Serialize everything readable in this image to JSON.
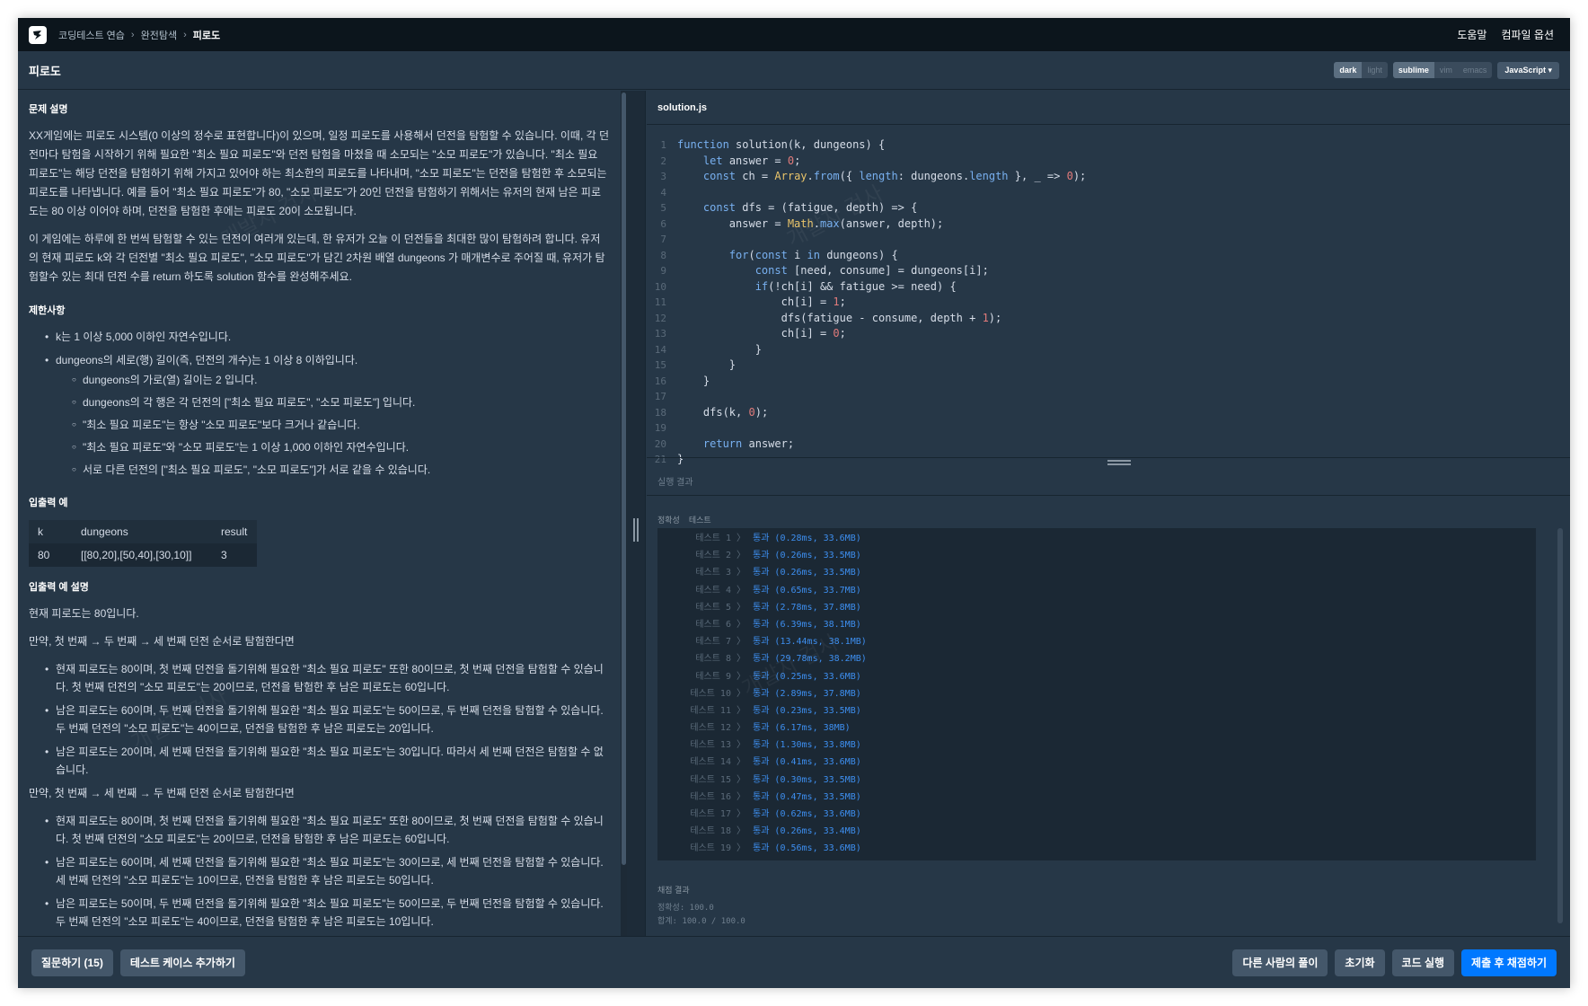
{
  "breadcrumb": [
    "코딩테스트 연습",
    "완전탐색",
    "피로도"
  ],
  "header_links": [
    "도움말",
    "컴파일 옵션"
  ],
  "title": "피로도",
  "theme_toggle": [
    "dark",
    "light"
  ],
  "keymap_toggle": [
    "sublime",
    "vim",
    "emacs"
  ],
  "language": "JavaScript",
  "problem": {
    "heading": "문제 설명",
    "paragraphs": [
      "XX게임에는 피로도 시스템(0 이상의 정수로 표현합니다)이 있으며, 일정 피로도를 사용해서 던전을 탐험할 수 있습니다. 이때, 각 던전마다 탐험을 시작하기 위해 필요한 \"최소 필요 피로도\"와 던전 탐험을 마쳤을 때 소모되는 \"소모 피로도\"가 있습니다. \"최소 필요 피로도\"는 해당 던전을 탐험하기 위해 가지고 있어야 하는 최소한의 피로도를 나타내며, \"소모 피로도\"는 던전을 탐험한 후 소모되는 피로도를 나타냅니다. 예를 들어 \"최소 필요 피로도\"가 80, \"소모 피로도\"가 20인 던전을 탐험하기 위해서는 유저의 현재 남은 피로도는 80 이상 이어야 하며, 던전을 탐험한 후에는 피로도 20이 소모됩니다.",
      "이 게임에는 하루에 한 번씩 탐험할 수 있는 던전이 여러개 있는데, 한 유저가 오늘 이 던전들을 최대한 많이 탐험하려 합니다. 유저의 현재 피로도 k와 각 던전별 \"최소 필요 피로도\", \"소모 피로도\"가 담긴 2차원 배열 dungeons 가 매개변수로 주어질 때, 유저가 탐험할수 있는 최대 던전 수를 return 하도록 solution 함수를 완성해주세요."
    ]
  },
  "constraints": {
    "heading": "제한사항",
    "item1": "k는 1 이상 5,000 이하인 자연수입니다.",
    "item2": "dungeons의 세로(행) 길이(즉, 던전의 개수)는 1 이상 8 이하입니다.",
    "sub": [
      "dungeons의 가로(열) 길이는 2 입니다.",
      "dungeons의 각 행은 각 던전의 [\"최소 필요 피로도\", \"소모 피로도\"] 입니다.",
      "\"최소 필요 피로도\"는 항상 \"소모 피로도\"보다 크거나 같습니다.",
      "\"최소 필요 피로도\"와 \"소모 피로도\"는 1 이상 1,000 이하인 자연수입니다.",
      "서로 다른 던전의 [\"최소 필요 피로도\", \"소모 피로도\"]가 서로 같을 수 있습니다."
    ]
  },
  "io_example": {
    "heading": "입출력 예",
    "columns": [
      "k",
      "dungeons",
      "result"
    ],
    "row": [
      "80",
      "[[80,20],[50,40],[30,10]]",
      "3"
    ]
  },
  "io_explain": {
    "heading": "입출력 예 설명",
    "intro": "현재 피로도는 80입니다.",
    "case1_title": "만약, 첫 번째 → 두 번째 → 세 번째 던전 순서로 탐험한다면",
    "case1": [
      "현재 피로도는 80이며, 첫 번째 던전을 돌기위해 필요한 \"최소 필요 피로도\" 또한 80이므로, 첫 번째 던전을 탐험할 수 있습니다. 첫 번째 던전의 \"소모 피로도\"는 20이므로, 던전을 탐험한 후 남은 피로도는 60입니다.",
      "남은 피로도는 60이며, 두 번째 던전을 돌기위해 필요한 \"최소 필요 피로도\"는 50이므로, 두 번째 던전을 탐험할 수 있습니다. 두 번째 던전의 \"소모 피로도\"는 40이므로, 던전을 탐험한 후 남은 피로도는 20입니다.",
      "남은 피로도는 20이며, 세 번째 던전을 돌기위해 필요한 \"최소 필요 피로도\"는 30입니다. 따라서 세 번째 던전은 탐험할 수 없습니다."
    ],
    "case2_title": "만약, 첫 번째 → 세 번째 → 두 번째 던전 순서로 탐험한다면",
    "case2": [
      "현재 피로도는 80이며, 첫 번째 던전을 돌기위해 필요한 \"최소 필요 피로도\" 또한 80이므로, 첫 번째 던전을 탐험할 수 있습니다. 첫 번째 던전의 \"소모 피로도\"는 20이므로, 던전을 탐험한 후 남은 피로도는 60입니다.",
      "남은 피로도는 60이며, 세 번째 던전을 돌기위해 필요한 \"최소 필요 피로도\"는 30이므로, 세 번째 던전을 탐험할 수 있습니다. 세 번째 던전의 \"소모 피로도\"는 10이므로, 던전을 탐험한 후 남은 피로도는 50입니다.",
      "남은 피로도는 50이며, 두 번째 던전을 돌기위해 필요한 \"최소 필요 피로도\"는 50이므로, 두 번째 던전을 탐험할 수 있습니다. 두 번째 던전의 \"소모 피로도\"는 40이므로, 던전을 탐험한 후 남은 피로도는 10입니다."
    ]
  },
  "editor": {
    "filename": "solution.js",
    "lines": [
      "function solution(k, dungeons) {",
      "    let answer = 0;",
      "    const ch = Array.from({ length: dungeons.length }, _ => 0);",
      "",
      "    const dfs = (fatigue, depth) => {",
      "        answer = Math.max(answer, depth);",
      "",
      "        for(const i in dungeons) {",
      "            const [need, consume] = dungeons[i];",
      "            if(!ch[i] && fatigue >= need) {",
      "                ch[i] = 1;",
      "                dfs(fatigue - consume, depth + 1);",
      "                ch[i] = 0;",
      "            }",
      "        }",
      "    }",
      "",
      "    dfs(k, 0);",
      "",
      "    return answer;",
      "}"
    ]
  },
  "results": {
    "label": "실행 결과",
    "subtabs": [
      "정확성",
      "테스트"
    ],
    "tests": [
      {
        "name": "테스트 1",
        "result": "통과 (0.28ms, 33.6MB)"
      },
      {
        "name": "테스트 2",
        "result": "통과 (0.26ms, 33.5MB)"
      },
      {
        "name": "테스트 3",
        "result": "통과 (0.26ms, 33.5MB)"
      },
      {
        "name": "테스트 4",
        "result": "통과 (0.65ms, 33.7MB)"
      },
      {
        "name": "테스트 5",
        "result": "통과 (2.78ms, 37.8MB)"
      },
      {
        "name": "테스트 6",
        "result": "통과 (6.39ms, 38.1MB)"
      },
      {
        "name": "테스트 7",
        "result": "통과 (13.44ms, 38.1MB)"
      },
      {
        "name": "테스트 8",
        "result": "통과 (29.78ms, 38.2MB)"
      },
      {
        "name": "테스트 9",
        "result": "통과 (0.25ms, 33.6MB)"
      },
      {
        "name": "테스트 10",
        "result": "통과 (2.89ms, 37.8MB)"
      },
      {
        "name": "테스트 11",
        "result": "통과 (0.23ms, 33.5MB)"
      },
      {
        "name": "테스트 12",
        "result": "통과 (6.17ms, 38MB)"
      },
      {
        "name": "테스트 13",
        "result": "통과 (1.30ms, 33.8MB)"
      },
      {
        "name": "테스트 14",
        "result": "통과 (0.41ms, 33.6MB)"
      },
      {
        "name": "테스트 15",
        "result": "통과 (0.30ms, 33.5MB)"
      },
      {
        "name": "테스트 16",
        "result": "통과 (0.47ms, 33.5MB)"
      },
      {
        "name": "테스트 17",
        "result": "통과 (0.62ms, 33.6MB)"
      },
      {
        "name": "테스트 18",
        "result": "통과 (0.26ms, 33.4MB)"
      },
      {
        "name": "테스트 19",
        "result": "통과 (0.56ms, 33.6MB)"
      }
    ],
    "grade_title": "채점 결과",
    "accuracy": "정확성: 100.0",
    "total": "합계: 100.0 / 100.0"
  },
  "buttons": {
    "ask": "질문하기 (15)",
    "add_testcase": "테스트 케이스 추가하기",
    "others": "다른 사람의 풀이",
    "reset": "초기화",
    "run": "코드 실행",
    "submit": "제출 후 채점하기"
  },
  "watermark": "개발자 검사"
}
